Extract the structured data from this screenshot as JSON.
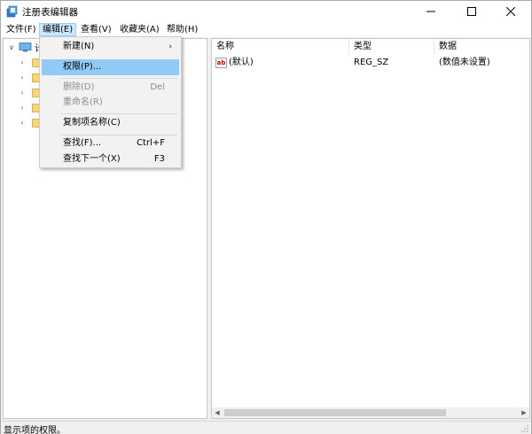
{
  "window": {
    "title": "注册表编辑器"
  },
  "menubar": {
    "items": [
      {
        "label": "文件(F)"
      },
      {
        "label": "编辑(E)"
      },
      {
        "label": "查看(V)"
      },
      {
        "label": "收藏夹(A)"
      },
      {
        "label": "帮助(H)"
      }
    ],
    "active_item": "编辑(E)"
  },
  "tree": {
    "root_label": "计",
    "children_count_visible": 5
  },
  "list": {
    "columns": [
      "名称",
      "类型",
      "数据"
    ],
    "rows": [
      {
        "name": "(默认)",
        "type": "REG_SZ",
        "data": "(数值未设置)",
        "icon": "reg-string-icon"
      }
    ]
  },
  "edit_menu": {
    "items": [
      {
        "label": "新建(N)",
        "shortcut": "",
        "submenu": true,
        "disabled": false,
        "highlight": false
      },
      {
        "label": "权限(P)...",
        "shortcut": "",
        "submenu": false,
        "disabled": false,
        "highlight": true
      },
      {
        "label": "删除(D)",
        "shortcut": "Del",
        "submenu": false,
        "disabled": true,
        "highlight": false
      },
      {
        "label": "重命名(R)",
        "shortcut": "",
        "submenu": false,
        "disabled": true,
        "highlight": false
      },
      {
        "label": "复制项名称(C)",
        "shortcut": "",
        "submenu": false,
        "disabled": false,
        "highlight": false
      },
      {
        "label": "查找(F)...",
        "shortcut": "Ctrl+F",
        "submenu": false,
        "disabled": false,
        "highlight": false
      },
      {
        "label": "查找下一个(X)",
        "shortcut": "F3",
        "submenu": false,
        "disabled": false,
        "highlight": false
      }
    ]
  },
  "statusbar": {
    "text": "显示项的权限。"
  },
  "colors": {
    "menu_highlight": "#91c9f7",
    "menubar_active": "#cce8ff",
    "folder": "#f5d77b",
    "disabled_text": "#8c8c8c"
  }
}
